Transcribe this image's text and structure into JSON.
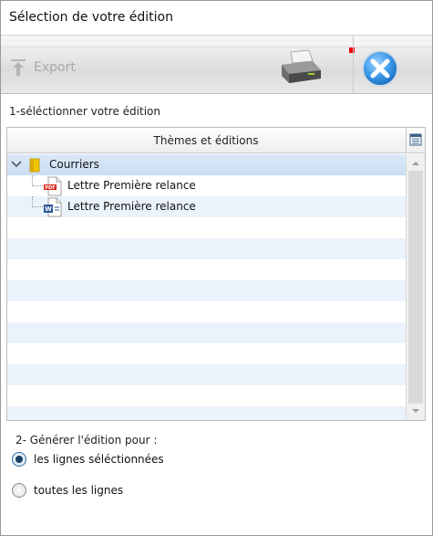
{
  "window": {
    "title": "Sélection de votre édition"
  },
  "toolbar": {
    "export_label": "Export",
    "export_enabled": false,
    "icons": [
      "export-arrow-icon",
      "printer-icon",
      "close-icon"
    ],
    "accent_color": "#2e8bd8"
  },
  "section1": {
    "label": "1-séléctionner votre édition"
  },
  "tree": {
    "column_header": "Thèmes et éditions",
    "nodes": [
      {
        "label": "Courriers",
        "type": "folder",
        "expanded": true,
        "selected": true
      },
      {
        "label": "Lettre Première relance",
        "type": "pdf-file"
      },
      {
        "label": "Lettre Première relance",
        "type": "word-file"
      }
    ]
  },
  "section2": {
    "label": "2- Générer l'édition pour :"
  },
  "options": [
    {
      "label": "les lignes séléctionnées",
      "checked": true
    },
    {
      "label": "toutes les lignes",
      "checked": false
    }
  ]
}
